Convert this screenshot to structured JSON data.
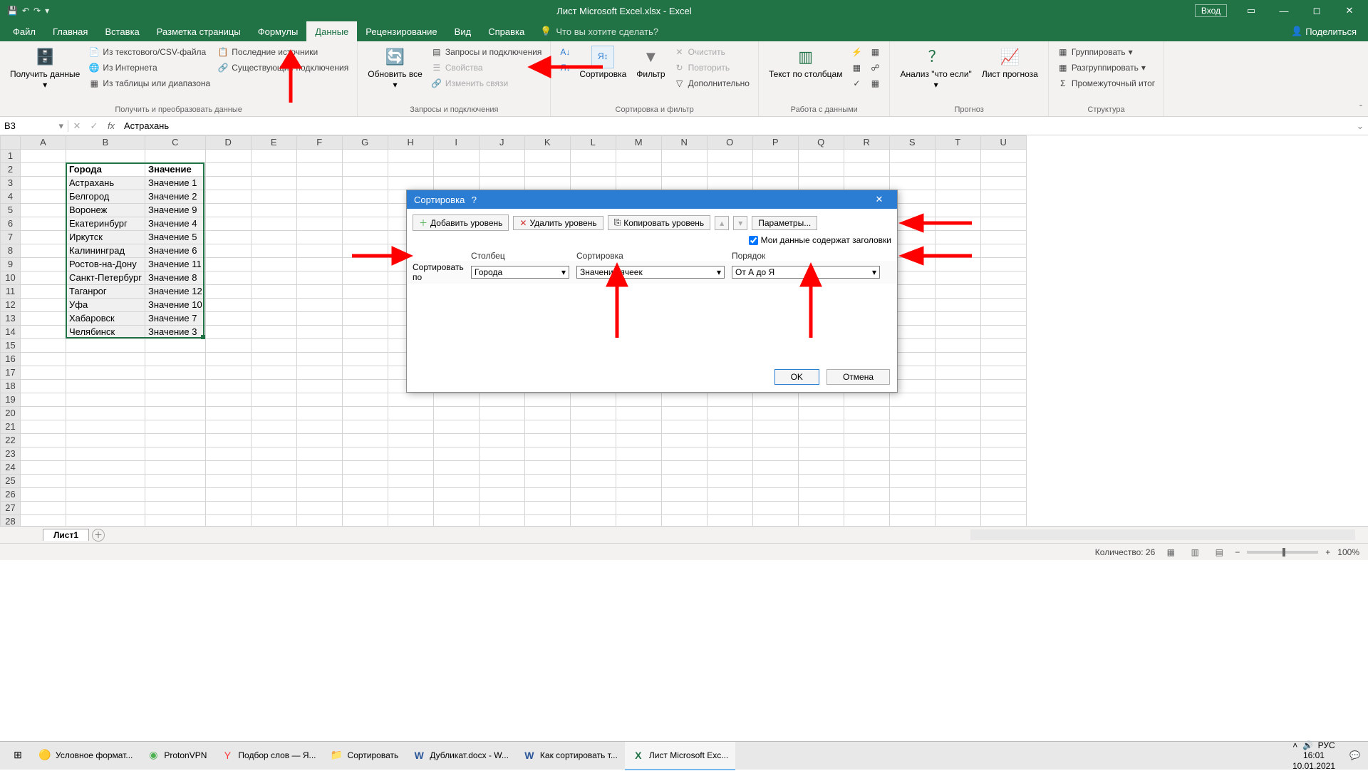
{
  "title": "Лист Microsoft Excel.xlsx  -  Excel",
  "login": "Вход",
  "tabs": [
    "Файл",
    "Главная",
    "Вставка",
    "Разметка страницы",
    "Формулы",
    "Данные",
    "Рецензирование",
    "Вид",
    "Справка"
  ],
  "active_tab": "Данные",
  "tell_me": "Что вы хотите сделать?",
  "share": "Поделиться",
  "ribbon": {
    "get_transform": {
      "label": "Получить и преобразовать данные",
      "get_data": "Получить данные",
      "csv": "Из текстового/CSV-файла",
      "web": "Из Интернета",
      "range": "Из таблицы или диапазона",
      "recent": "Последние источники",
      "existing": "Существующие подключения"
    },
    "queries": {
      "label": "Запросы и подключения",
      "refresh": "Обновить все",
      "q1": "Запросы и подключения",
      "q2": "Свойства",
      "q3": "Изменить связи"
    },
    "sort_filter": {
      "label": "Сортировка и фильтр",
      "sort": "Сортировка",
      "filter": "Фильтр",
      "clear": "Очистить",
      "reapply": "Повторить",
      "advanced": "Дополнительно"
    },
    "data_tools": {
      "label": "Работа с данными",
      "txtcols": "Текст по столбцам"
    },
    "forecast": {
      "label": "Прогноз",
      "whatif": "Анализ \"что если\"",
      "sheet": "Лист прогноза"
    },
    "outline": {
      "label": "Структура",
      "group": "Группировать",
      "ungroup": "Разгруппировать",
      "subtotal": "Промежуточный итог"
    }
  },
  "namebox": "B3",
  "formula": "Астрахань",
  "columns": [
    "A",
    "B",
    "C",
    "D",
    "E",
    "F",
    "G",
    "H",
    "I",
    "J",
    "K",
    "L",
    "M",
    "N",
    "O",
    "P",
    "Q",
    "R",
    "S",
    "T",
    "U"
  ],
  "header_row": {
    "B": "Города",
    "C": "Значение"
  },
  "data_rows": [
    {
      "B": "Астрахань",
      "C": "Значение 1"
    },
    {
      "B": "Белгород",
      "C": "Значение 2"
    },
    {
      "B": "Воронеж",
      "C": "Значение 9"
    },
    {
      "B": "Екатеринбург",
      "C": "Значение 4"
    },
    {
      "B": "Иркутск",
      "C": "Значение 5"
    },
    {
      "B": "Калининград",
      "C": "Значение 6"
    },
    {
      "B": "Ростов-на-Дону",
      "C": "Значение 11"
    },
    {
      "B": "Санкт-Петербург",
      "C": "Значение 8"
    },
    {
      "B": "Таганрог",
      "C": "Значение 12"
    },
    {
      "B": "Уфа",
      "C": "Значение 10"
    },
    {
      "B": "Хабаровск",
      "C": "Значение 7"
    },
    {
      "B": "Челябинск",
      "C": "Значение 3"
    }
  ],
  "sheet_tab": "Лист1",
  "status_count": "Количество: 26",
  "zoom": "100%",
  "dlg": {
    "title": "Сортировка",
    "add": "Добавить уровень",
    "del": "Удалить уровень",
    "copy": "Копировать уровень",
    "params": "Параметры...",
    "headers": "Мои данные содержат заголовки",
    "h_col": "Столбец",
    "h_sort": "Сортировка",
    "h_order": "Порядок",
    "sortby": "Сортировать по",
    "v_col": "Города",
    "v_sort": "Значения ячеек",
    "v_order": "От А до Я",
    "ok": "OK",
    "cancel": "Отмена"
  },
  "taskbar": {
    "chrome": "Условное формат...",
    "proton": "ProtonVPN",
    "yandex": "Подбор слов — Я...",
    "folder": "Сортировать",
    "word1": "Дубликат.docx - W...",
    "word2": "Как сортировать т...",
    "excel": "Лист Microsoft Exc...",
    "lang": "РУС",
    "time": "16:01",
    "date": "10.01.2021"
  }
}
